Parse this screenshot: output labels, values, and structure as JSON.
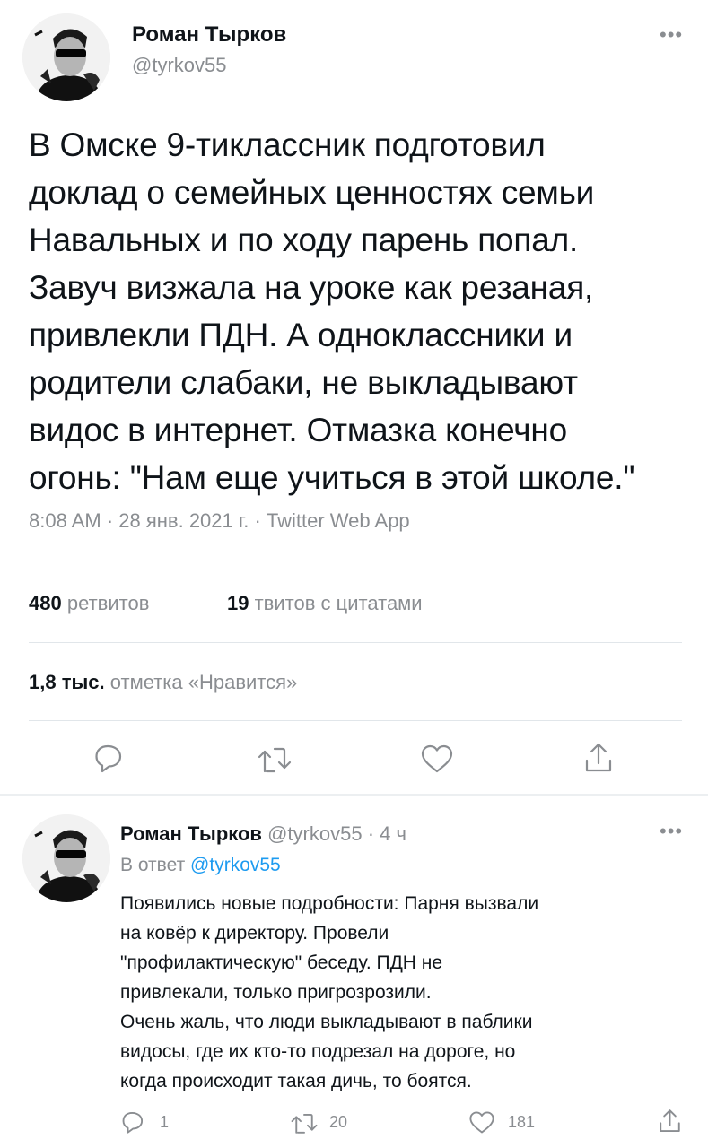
{
  "main_tweet": {
    "author_name": "Роман Тырков",
    "author_handle": "@tyrkov55",
    "more_icon": "more-dots-icon",
    "text": "В Омске 9-тиклассник подготовил\nдоклад о семейных ценностях семьи\nНавальных и по ходу парень попал.\nЗавуч визжала на уроке как резаная,\nпривлекли ПДН. А одноклассники и\nродители слабаки, не выкладывают\nвидос в интернет. Отмазка конечно\nогонь: \"Нам еще учиться в этой школе.\"",
    "meta": "8:08 AM · 28 янв. 2021 г. · Twitter Web App",
    "retweets_count": "480",
    "retweets_label": "ретвитов",
    "quotes_count": "19",
    "quotes_label": "твитов с цитатами",
    "likes_count": "1,8 тыс.",
    "likes_label": "отметка «Нравится»"
  },
  "reply_tweet": {
    "author_name": "Роман Тырков",
    "author_handle": "@tyrkov55",
    "time": "· 4 ч",
    "reply_to_prefix": "В ответ",
    "reply_to_handle": "@tyrkov55",
    "text": "Появились новые подробности: Парня вызвали\nна ковёр к директору. Провели\n\"профилактическую\" беседу. ПДН не\nпривлекали, только пригрозрозили.\nОчень жаль, что люди выкладывают в паблики\nвидосы, где их кто-то подрезал на дороге, но\nкогда происходит такая дичь, то боятся.",
    "reply_count": "1",
    "retweet_count": "20",
    "like_count": "181"
  },
  "colors": {
    "text": "#0f1419",
    "muted": "#8a8d91",
    "link": "#1d9bf0",
    "divider": "#e1e6ea"
  }
}
